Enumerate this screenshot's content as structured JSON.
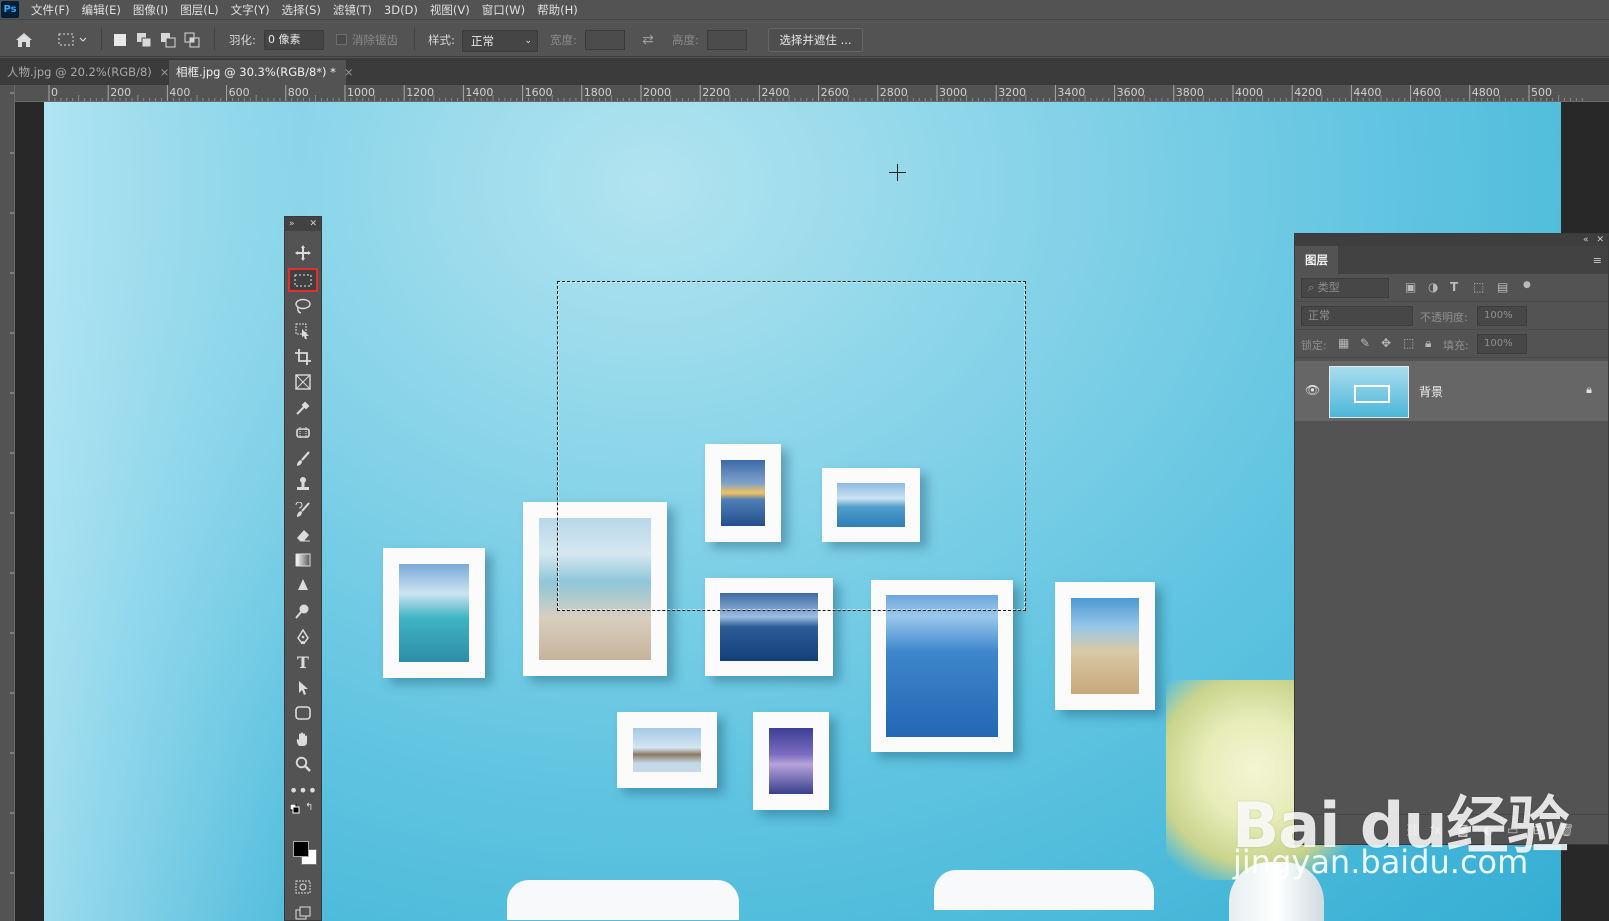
{
  "app": {
    "logo": "Ps"
  },
  "menu": [
    "文件(F)",
    "编辑(E)",
    "图像(I)",
    "图层(L)",
    "文字(Y)",
    "选择(S)",
    "滤镜(T)",
    "3D(D)",
    "视图(V)",
    "窗口(W)",
    "帮助(H)"
  ],
  "options": {
    "feather_label": "羽化:",
    "feather_value": "0 像素",
    "antialias_label": "消除锯齿",
    "style_label": "样式:",
    "style_value": "正常",
    "width_label": "宽度:",
    "height_label": "高度:",
    "select_mask_button": "选择并遮住 ..."
  },
  "tabs": [
    {
      "label": "人物.jpg @ 20.2%(RGB/8)",
      "close": "×"
    },
    {
      "label": "相框.jpg @ 30.3%(RGB/8*) *",
      "close": "×"
    }
  ],
  "ruler": {
    "h_ticks": [
      "0",
      "200",
      "400",
      "600",
      "800",
      "1000",
      "1200",
      "1400",
      "1600",
      "1800",
      "2000",
      "2200",
      "2400",
      "2600",
      "2800",
      "3000",
      "3200",
      "3400",
      "3600",
      "3800",
      "4000",
      "4200",
      "4400",
      "4600",
      "4800",
      "500"
    ]
  },
  "toolbar": {
    "active_tool": "rectangular-marquee-tool",
    "tools": [
      "move-tool",
      "rectangular-marquee-tool",
      "lasso-tool",
      "object-select-tool",
      "crop-tool",
      "frame-tool",
      "eyedropper-tool",
      "spot-healing-tool",
      "brush-tool",
      "clone-stamp-tool",
      "history-brush-tool",
      "eraser-tool",
      "gradient-tool",
      "blur-tool",
      "dodge-tool",
      "pen-tool",
      "type-tool",
      "path-selection-tool",
      "rectangle-tool",
      "hand-tool",
      "zoom-tool",
      "more-tools"
    ],
    "foreground_color": "#000000",
    "background_color": "#ffffff"
  },
  "layers_panel": {
    "title": "图层",
    "filter_placeholder": "类型",
    "blend_mode": "正常",
    "opacity_label": "不透明度:",
    "opacity_value": "100%",
    "lock_label": "锁定:",
    "fill_label": "填充:",
    "fill_value": "100%",
    "layers": [
      {
        "name": "背景",
        "visible": true,
        "locked": true
      }
    ]
  },
  "watermark": {
    "logo": "Bai du经验",
    "url": "jingyan.baidu.com"
  },
  "colors": {
    "accent_selected_tool": "#e52f2f",
    "ui_bg": "#535353",
    "canvas_bg": "#282828"
  }
}
